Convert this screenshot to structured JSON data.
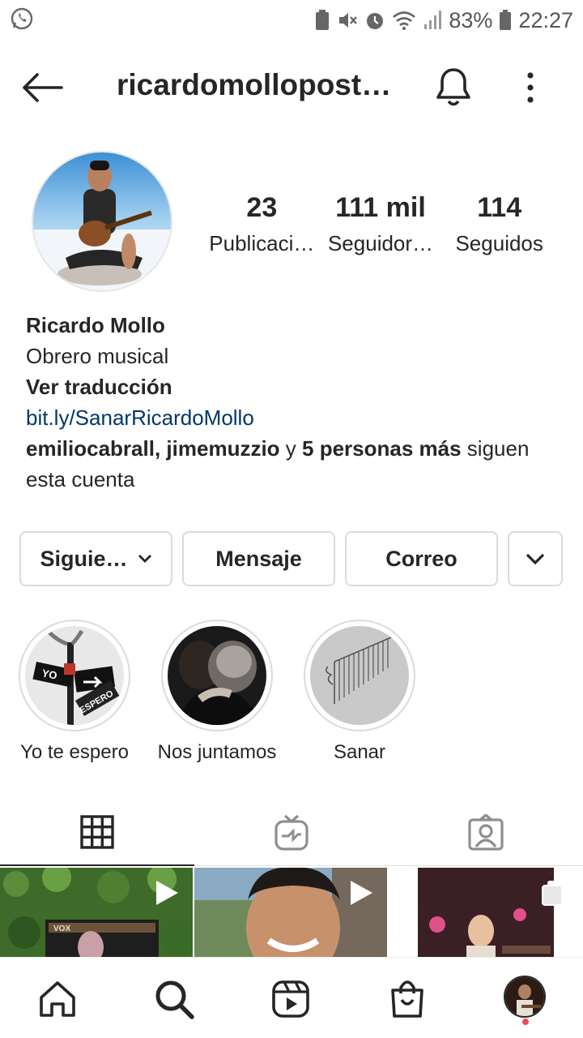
{
  "status_bar": {
    "battery": "83%",
    "time": "22:27"
  },
  "header": {
    "username": "ricardomollopost…"
  },
  "profile": {
    "stats": [
      {
        "number": "23",
        "label": "Publicaci…"
      },
      {
        "number": "111 mil",
        "label": "Seguidor…"
      },
      {
        "number": "114",
        "label": "Seguidos"
      }
    ],
    "name": "Ricardo Mollo",
    "bio": "Obrero musical",
    "translate": "Ver traducción",
    "link": "bit.ly/SanarRicardoMollo",
    "followed_by": {
      "user1": "emiliocabrall",
      "sep": ", ",
      "user2": "jimemuzzio",
      "and": " y ",
      "others": "5 personas más",
      "tail": " siguen esta cuenta"
    }
  },
  "actions": {
    "follow": "Siguie…",
    "message": "Mensaje",
    "email": "Correo"
  },
  "highlights": [
    {
      "label": "Yo te espero"
    },
    {
      "label": "Nos juntamos"
    },
    {
      "label": "Sanar"
    }
  ],
  "colors": {
    "link": "#00376b",
    "text": "#262626",
    "border": "#dbdbdb",
    "notification_dot": "#ed4956"
  }
}
